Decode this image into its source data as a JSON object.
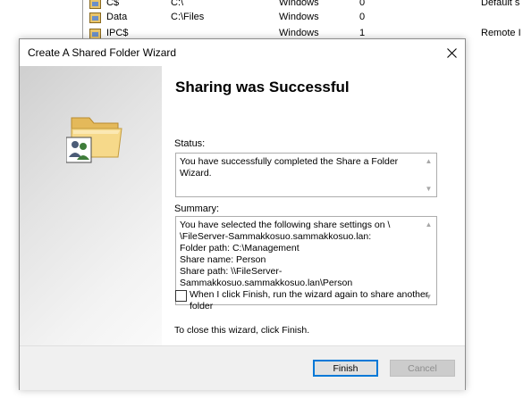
{
  "background_list": {
    "rows": [
      {
        "name": "C$",
        "path": "C:\\",
        "os": "Windows",
        "count": "0",
        "description": "Default s"
      },
      {
        "name": "Data",
        "path": "C:\\Files",
        "os": "Windows",
        "count": "0",
        "description": ""
      },
      {
        "name": "IPC$",
        "path": "",
        "os": "Windows",
        "count": "1",
        "description": "Remote I"
      }
    ]
  },
  "dialog": {
    "title": "Create A Shared Folder Wizard",
    "heading": "Sharing was Successful",
    "status_label": "Status:",
    "status_text": "You have successfully completed the Share a Folder Wizard.",
    "summary_label": "Summary:",
    "summary_lines": [
      "You have selected the following share settings on \\",
      "\\FileServer-Sammakkosuo.sammakkosuo.lan:",
      "Folder path: C:\\Management",
      "Share name: Person",
      "Share path: \\\\FileServer-",
      "Sammakkosuo.sammakkosuo.lan\\Person"
    ],
    "run_again_label": "When I click Finish, run the wizard again to share another folder",
    "run_again_checked": false,
    "close_instruction": "To close this wizard, click Finish.",
    "finish_label": "Finish",
    "cancel_label": "Cancel"
  },
  "colors": {
    "accent_border": "#0078d7",
    "dialog_bg": "#f0f0f0",
    "disabled_text": "#8d8d8d"
  },
  "icons": [
    "share-icon",
    "close-icon",
    "shared-folder-icon",
    "users-icon",
    "scroll-up-icon",
    "scroll-down-icon"
  ]
}
